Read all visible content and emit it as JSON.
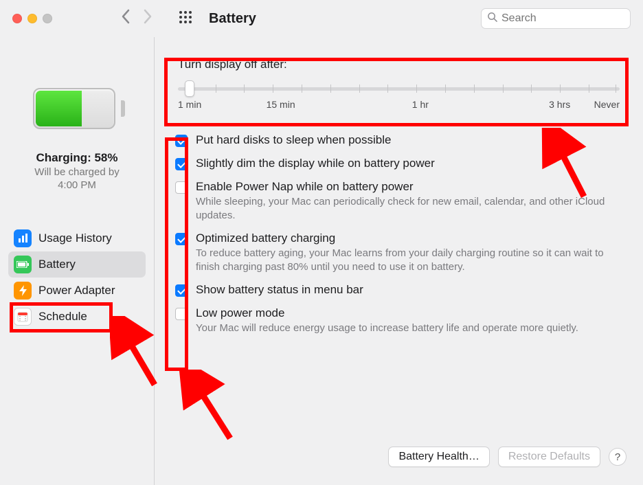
{
  "window": {
    "title": "Battery",
    "search_placeholder": "Search"
  },
  "sidebar": {
    "status_title": "Charging: 58%",
    "status_sub1": "Will be charged by",
    "status_sub2": "4:00 PM",
    "items": [
      {
        "label": "Usage History"
      },
      {
        "label": "Battery"
      },
      {
        "label": "Power Adapter"
      },
      {
        "label": "Schedule"
      }
    ]
  },
  "slider": {
    "label": "Turn display off after:",
    "marks": {
      "m0": "1 min",
      "m1": "15 min",
      "m2": "1 hr",
      "m3": "3 hrs",
      "m4": "Never"
    }
  },
  "options": [
    {
      "checked": true,
      "label": "Put hard disks to sleep when possible",
      "desc": ""
    },
    {
      "checked": true,
      "label": "Slightly dim the display while on battery power",
      "desc": ""
    },
    {
      "checked": false,
      "label": "Enable Power Nap while on battery power",
      "desc": "While sleeping, your Mac can periodically check for new email, calendar, and other iCloud updates."
    },
    {
      "checked": true,
      "label": "Optimized battery charging",
      "desc": "To reduce battery aging, your Mac learns from your daily charging routine so it can wait to finish charging past 80% until you need to use it on battery."
    },
    {
      "checked": true,
      "label": "Show battery status in menu bar",
      "desc": ""
    },
    {
      "checked": false,
      "label": "Low power mode",
      "desc": "Your Mac will reduce energy usage to increase battery life and operate more quietly."
    }
  ],
  "footer": {
    "battery_health": "Battery Health…",
    "restore_defaults": "Restore Defaults",
    "help": "?"
  }
}
